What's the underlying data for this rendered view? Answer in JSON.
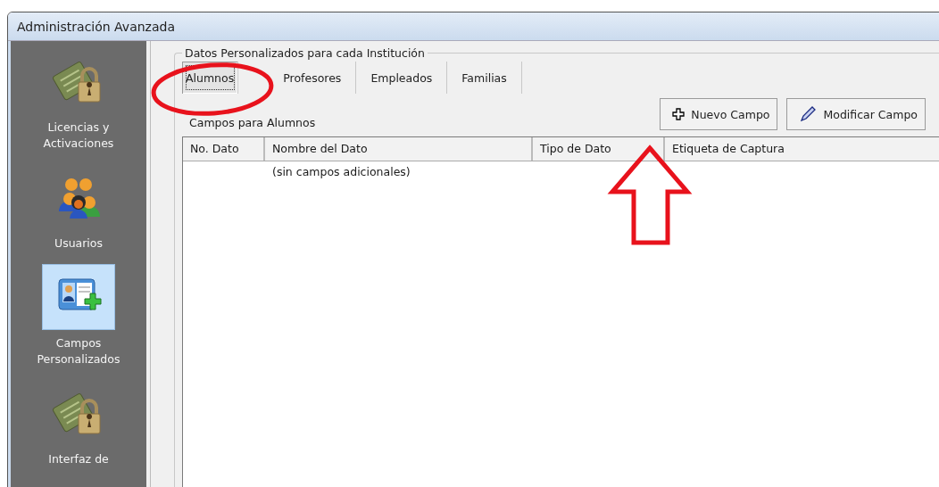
{
  "window": {
    "title": "Administración Avanzada"
  },
  "sidebar": {
    "items": [
      {
        "kind": "license",
        "label": "Licencias y Activaciones",
        "selected": false
      },
      {
        "kind": "users",
        "label": "Usuarios",
        "selected": false
      },
      {
        "kind": "fields",
        "label": "Campos Personalizados",
        "selected": true
      },
      {
        "kind": "license",
        "label": "Interfaz de",
        "selected": false
      }
    ]
  },
  "group": {
    "title": "Datos Personalizados para cada Institución"
  },
  "tabs": [
    {
      "label": "Alumnos",
      "selected": true
    },
    {
      "label": "Profesores",
      "selected": false
    },
    {
      "label": "Empleados",
      "selected": false
    },
    {
      "label": "Familias",
      "selected": false
    }
  ],
  "section_label": "Campos para Alumnos",
  "buttons": [
    {
      "kind": "add",
      "label": "Nuevo Campo"
    },
    {
      "kind": "edit",
      "label": "Modificar Campo"
    }
  ],
  "table": {
    "columns": [
      "No. Dato",
      "Nombre del Dato",
      "Tipo de Dato",
      "Etiqueta de Captura"
    ],
    "empty_text": "(sin campos adicionales)"
  }
}
